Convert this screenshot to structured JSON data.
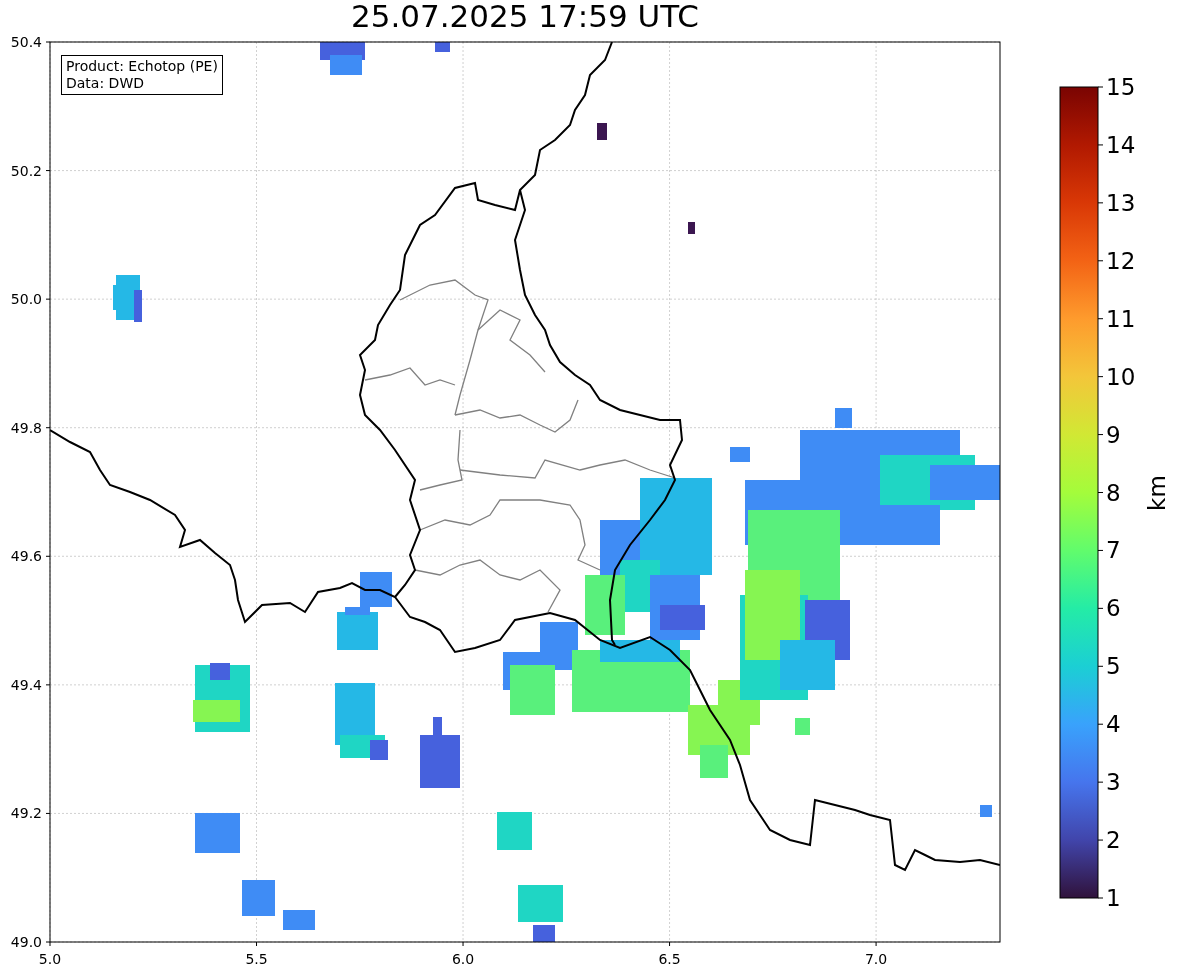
{
  "title": "25.07.2025 17:59 UTC",
  "legend": {
    "lines": [
      "Product: Echotop (PE)",
      "Data: DWD"
    ]
  },
  "map": {
    "x_ticks": [
      "5.0",
      "5.5",
      "6.0",
      "6.5",
      "7.0"
    ],
    "y_ticks": [
      "50.4",
      "50.2",
      "50.0",
      "49.8",
      "49.6",
      "49.4",
      "49.2",
      "49.0"
    ]
  },
  "colorbar": {
    "label": "km",
    "ticks": [
      "15",
      "14",
      "13",
      "12",
      "11",
      "10",
      "9",
      "8",
      "7",
      "6",
      "5",
      "4",
      "3",
      "2",
      "1"
    ]
  }
}
